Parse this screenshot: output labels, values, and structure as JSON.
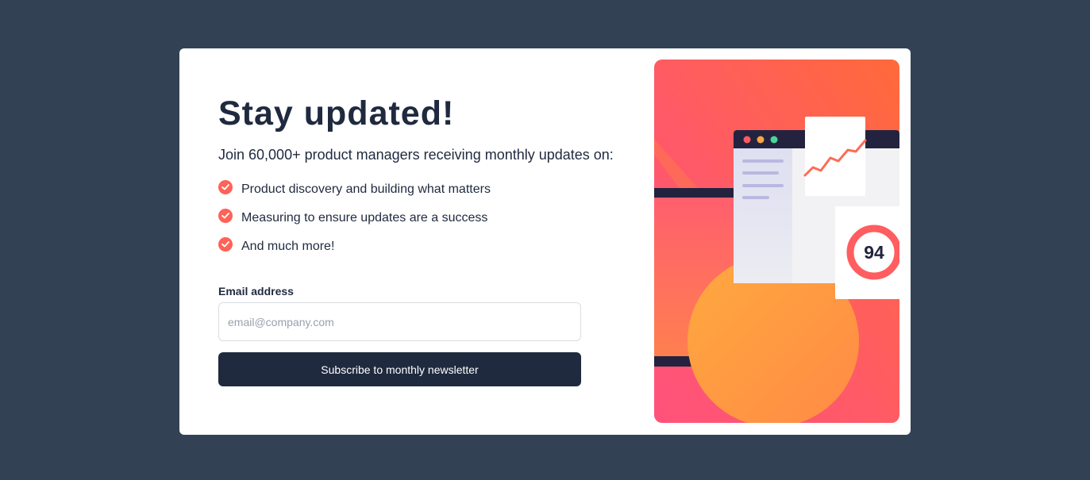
{
  "newsletter": {
    "title": "Stay updated!",
    "subtitle": "Join 60,000+ product managers receiving monthly updates on:",
    "features": [
      "Product discovery and building what matters",
      "Measuring to ensure updates are a success",
      "And much more!"
    ],
    "email_label": "Email address",
    "email_placeholder": "email@company.com",
    "email_value": "",
    "subscribe_label": "Subscribe to monthly newsletter"
  },
  "illustration": {
    "score": "94",
    "icons": [
      "check-icon",
      "window-dots-icon",
      "line-chart-icon",
      "score-ring-icon"
    ]
  },
  "colors": {
    "accent": "#ff6257",
    "dark": "#1f2a3f",
    "background": "#334155",
    "gradient_start": "#ff6a3d",
    "gradient_end": "#ff527b"
  }
}
